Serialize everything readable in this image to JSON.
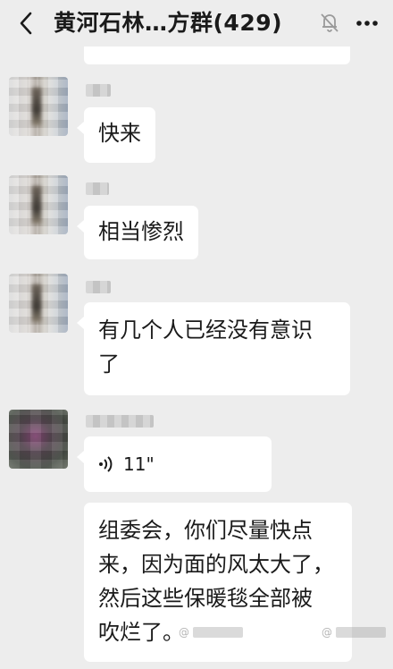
{
  "header": {
    "title": "黄河石林…方群(429)",
    "back_icon": "chevron-left-icon",
    "mute_icon": "bell-off-icon",
    "more_icon": "more-dots-icon"
  },
  "messages": [
    {
      "avatar": "blurred-avatar",
      "text": "快来"
    },
    {
      "avatar": "blurred-avatar",
      "text": "相当惨烈"
    },
    {
      "avatar": "blurred-avatar",
      "text_line1": "有几个人已经没有意识",
      "text_line2": "了"
    },
    {
      "avatar": "blurred-avatar",
      "voice_duration": "11\"",
      "text_lines": [
        "组委会，你们尽量快点",
        "来，因为面的风太大了，",
        "然后这些保暖毯全部被",
        "吹烂了。"
      ]
    }
  ],
  "watermarks": [
    "@",
    "@"
  ],
  "colors": {
    "background": "#ededed",
    "bubble": "#ffffff",
    "text": "#1a1a1a"
  }
}
